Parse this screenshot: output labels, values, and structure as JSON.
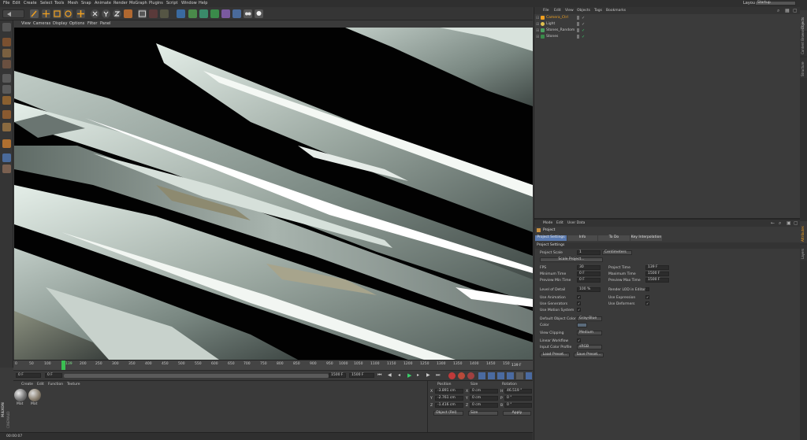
{
  "menu": [
    "File",
    "Edit",
    "Create",
    "Select",
    "Tools",
    "Mesh",
    "Snap",
    "Animate",
    "Render",
    "MoGraph",
    "Plugins",
    "Script",
    "Window",
    "Help"
  ],
  "layout": {
    "label": "Layout:",
    "value": "Startup"
  },
  "viewport": {
    "menu": [
      "View",
      "Cameras",
      "Display",
      "Options",
      "Filter",
      "Panel"
    ]
  },
  "timeline": {
    "ticks": [
      "0",
      "50",
      "100",
      "139",
      "200",
      "250",
      "300",
      "350",
      "400",
      "450",
      "500",
      "550",
      "600",
      "650",
      "700",
      "750",
      "800",
      "850",
      "900",
      "950",
      "1000",
      "1050",
      "1100",
      "1150",
      "1200",
      "1250",
      "1300",
      "1350",
      "1400",
      "1450",
      "150"
    ],
    "current_frame": "139 F",
    "start_field": "0 F",
    "range_min": "0 F",
    "range_max": "1500 F",
    "end_field": "1500 F"
  },
  "material_manager": {
    "menu": [
      "Create",
      "Edit",
      "Function",
      "Texture"
    ],
    "materials": [
      {
        "name": "Mat"
      },
      {
        "name": "Mat"
      }
    ]
  },
  "coordinates": {
    "headers": [
      "Position",
      "Size",
      "Rotation"
    ],
    "rows": [
      {
        "axis": "X",
        "position": "-3.891 cm",
        "size_axis": "X",
        "size": "0 cm",
        "rot_axis": "H",
        "rotation": "46.519 °"
      },
      {
        "axis": "Y",
        "position": "-2.761 cm",
        "size_axis": "Y",
        "size": "0 cm",
        "rot_axis": "P",
        "rotation": "0 °"
      },
      {
        "axis": "Z",
        "position": "-1.416 cm",
        "size_axis": "Z",
        "size": "0 cm",
        "rot_axis": "B",
        "rotation": "0 °"
      }
    ],
    "mode_dropdown": "Object (Rel)",
    "size_dropdown": "Size",
    "apply": "Apply"
  },
  "status": {
    "time": "00:00:07"
  },
  "brand": {
    "line1": "MAXON",
    "line2": "CINEMA4D"
  },
  "object_manager": {
    "menu": [
      "File",
      "Edit",
      "View",
      "Objects",
      "Tags",
      "Bookmarks"
    ],
    "objects": [
      {
        "name": "Camera_Ctrl",
        "color": "#f0a020"
      },
      {
        "name": "Light",
        "color": "#cfcfcf"
      },
      {
        "name": "Stones_Random",
        "color": "#cfcfcf"
      },
      {
        "name": "Stones",
        "color": "#cfcfcf"
      }
    ]
  },
  "attributes": {
    "menu": [
      "Mode",
      "Edit",
      "User Data"
    ],
    "title": "Project",
    "tabs": [
      "Project Settings",
      "Info",
      "To Do",
      "Key Interpolation"
    ],
    "section": "Project Settings",
    "project_scale_label": "Project Scale",
    "project_scale_value": "1",
    "project_scale_unit": "Centimeters",
    "scale_project_btn": "Scale Project...",
    "fps_label": "FPS",
    "fps_value": "30",
    "project_time_label": "Project Time",
    "project_time_value": "139 F",
    "min_time_label": "Minimum Time",
    "min_time_value": "0 F",
    "max_time_label": "Maximum Time",
    "max_time_value": "1500 F",
    "preview_min_label": "Preview Min Time",
    "preview_min_value": "0 F",
    "preview_max_label": "Preview Max Time",
    "preview_max_value": "1500 F",
    "lod_label": "Level of Detail",
    "lod_value": "100 %",
    "render_lod_label": "Render LOD in Editor",
    "use_animation_label": "Use Animation",
    "use_expression_label": "Use Expression",
    "use_generators_label": "Use Generators",
    "use_deformers_label": "Use Deformers",
    "use_motion_label": "Use Motion System",
    "default_color_label": "Default Object Color",
    "default_color_value": "Gray-Blue",
    "color_label": "Color",
    "view_clipping_label": "View Clipping",
    "view_clipping_value": "Medium",
    "linear_workflow_label": "Linear Workflow",
    "input_profile_label": "Input Color Profile",
    "input_profile_value": "sRGB",
    "load_preset": "Load Preset...",
    "save_preset": "Save Preset...",
    "check_mark": "✓"
  },
  "side_tabs": [
    "Objects",
    "Content Browser",
    "Structure",
    "Attributes",
    "Layers"
  ]
}
